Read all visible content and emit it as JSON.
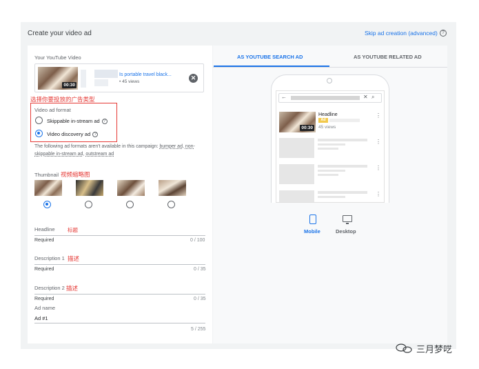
{
  "header": {
    "title": "Create your video ad",
    "skip_link": "Skip ad creation (advanced)",
    "help_glyph": "?"
  },
  "video": {
    "section_label": "Your YouTube Video",
    "title": "Is portable travel black...",
    "views": "• 45 views",
    "duration": "00:30",
    "remove_glyph": "✕"
  },
  "format": {
    "annotation": "选择你要投放的广告类型",
    "label": "Video ad format",
    "options": [
      {
        "label": "Skippable in-stream ad",
        "selected": false
      },
      {
        "label": "Video discovery ad",
        "selected": true
      }
    ],
    "help_glyph": "?",
    "note_text": "The following ad formats aren't available in this campaign:",
    "note_items": [
      "bumper ad",
      "non-skippable in-stream ad",
      "outstream ad"
    ]
  },
  "thumbnail": {
    "label": "Thumbnail",
    "annotation": "视频缩略图",
    "selected_index": 0,
    "count": 4
  },
  "fields": {
    "headline": {
      "label": "Headline",
      "annotation": "标题",
      "required": "Required",
      "counter": "0 / 100"
    },
    "description1": {
      "label": "Description 1",
      "annotation": "描述",
      "required": "Required",
      "counter": "0 / 35"
    },
    "description2": {
      "label": "Description 2",
      "annotation": "描述",
      "required": "Required",
      "counter": "0 / 35"
    },
    "ad_name": {
      "label": "Ad name",
      "value": "Ad #1",
      "counter": "5 / 255"
    }
  },
  "preview": {
    "tabs": [
      {
        "label": "AS YOUTUBE SEARCH AD",
        "active": true
      },
      {
        "label": "AS YOUTUBE RELATED AD",
        "active": false
      }
    ],
    "search_back": "←",
    "search_clear": "✕",
    "search_glyph": "⌕",
    "headline": "Headline",
    "ad_badge": "Ad",
    "views": "45 views",
    "duration": "00:30",
    "more_glyph": "⋮",
    "devices": [
      {
        "label": "Mobile",
        "active": true
      },
      {
        "label": "Desktop",
        "active": false
      }
    ]
  },
  "watermark": {
    "text": "三月梦呓"
  },
  "colors": {
    "accent": "#1a73e8",
    "annotation_red": "#e53935"
  }
}
